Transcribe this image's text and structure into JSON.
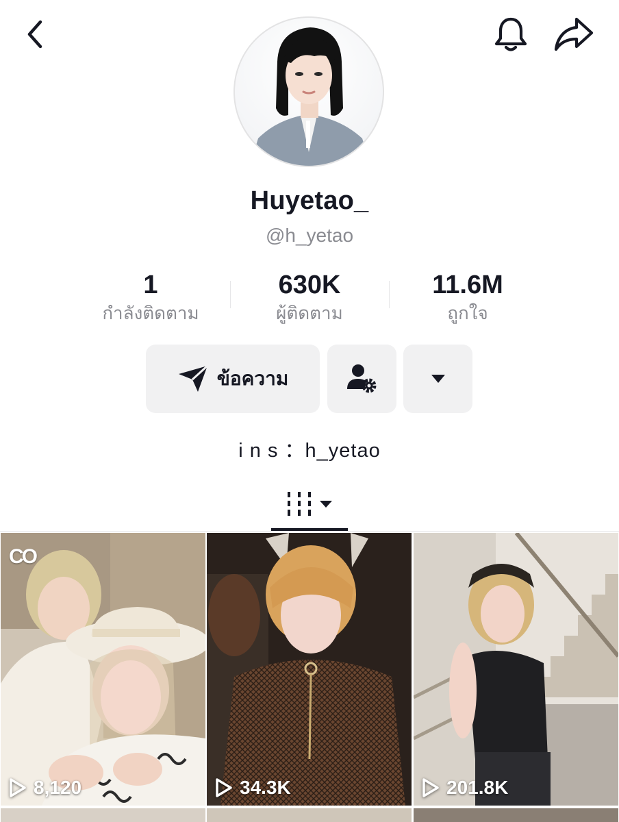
{
  "header": {
    "back_icon": "chevron-left-icon",
    "bell_icon": "bell-icon",
    "share_icon": "share-arrow-icon"
  },
  "profile": {
    "display_name": "Huyetao_",
    "username": "@h_yetao",
    "bio": "i n s  ：h_yetao"
  },
  "stats": [
    {
      "value": "1",
      "label": "กำลังติดตาม"
    },
    {
      "value": "630K",
      "label": "ผู้ติดตาม"
    },
    {
      "value": "11.6M",
      "label": "ถูกใจ"
    }
  ],
  "actions": {
    "message_label": "ข้อความ",
    "message_icon": "send-icon",
    "friend_icon": "user-settings-icon",
    "more_icon": "caret-down-icon"
  },
  "tabs": {
    "videos_icon": "grid-icon",
    "dropdown_icon": "caret-down-icon"
  },
  "videos": [
    {
      "views": "8,120",
      "badge": "CO"
    },
    {
      "views": "34.3K"
    },
    {
      "views": "201.8K"
    }
  ],
  "colors": {
    "text": "#161823",
    "secondary_text": "#8a8b91",
    "button_bg": "#f1f1f2"
  }
}
